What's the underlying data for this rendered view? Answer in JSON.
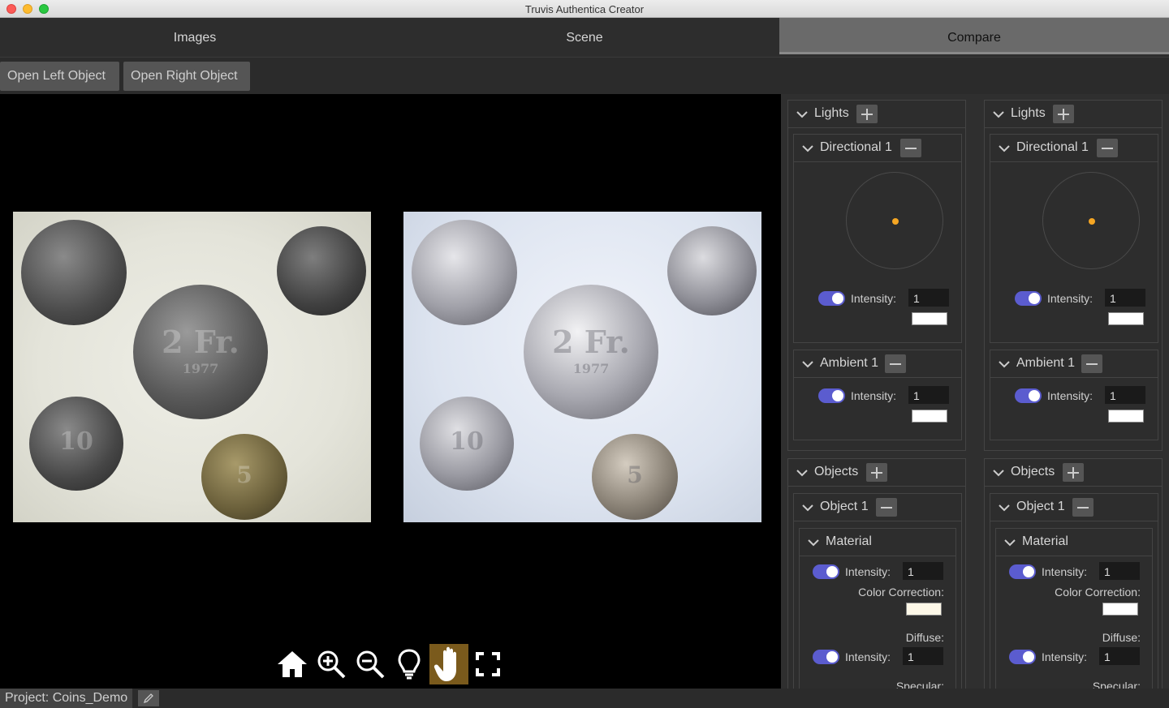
{
  "window": {
    "title": "Truvis Authentica Creator"
  },
  "tabs": [
    {
      "label": "Images"
    },
    {
      "label": "Scene"
    },
    {
      "label": "Compare"
    }
  ],
  "toolbar": {
    "open_left": "Open Left Object",
    "open_right": "Open Right Object"
  },
  "coins": {
    "two_franc": "2 Fr.",
    "year": "1977",
    "ten": "10",
    "five": "5"
  },
  "viewer_tools": [
    "home-icon",
    "zoom-in-icon",
    "zoom-out-icon",
    "lightbulb-icon",
    "hand-icon",
    "fullscreen-icon"
  ],
  "left_panel": {
    "lights_title": "Lights",
    "directional_title": "Directional 1",
    "directional_intensity_label": "Intensity:",
    "directional_intensity": "1",
    "directional_color": "#ffffff",
    "ambient_title": "Ambient 1",
    "ambient_intensity_label": "Intensity:",
    "ambient_intensity": "1",
    "ambient_color": "#ffffff",
    "objects_title": "Objects",
    "object_title": "Object 1",
    "material_title": "Material",
    "material_intensity_label": "Intensity:",
    "material_intensity": "1",
    "color_correction_label": "Color Correction:",
    "color_correction": "#fdf8e8",
    "diffuse_label": "Diffuse:",
    "diffuse_intensity_label": "Intensity:",
    "diffuse_intensity": "1",
    "specular_label": "Specular:"
  },
  "right_panel": {
    "lights_title": "Lights",
    "directional_title": "Directional 1",
    "directional_intensity_label": "Intensity:",
    "directional_intensity": "1",
    "directional_color": "#ffffff",
    "ambient_title": "Ambient 1",
    "ambient_intensity_label": "Intensity:",
    "ambient_intensity": "1",
    "ambient_color": "#ffffff",
    "objects_title": "Objects",
    "object_title": "Object 1",
    "material_title": "Material",
    "material_intensity_label": "Intensity:",
    "material_intensity": "1",
    "color_correction_label": "Color Correction:",
    "color_correction": "#ffffff",
    "diffuse_label": "Diffuse:",
    "diffuse_intensity_label": "Intensity:",
    "diffuse_intensity": "1",
    "specular_label": "Specular:"
  },
  "status": {
    "project": "Project: Coins_Demo"
  },
  "colors": {
    "accent_toggle": "#5b5ccf",
    "light_dot": "#f5a623",
    "active_tool": "#7a5a1c"
  }
}
